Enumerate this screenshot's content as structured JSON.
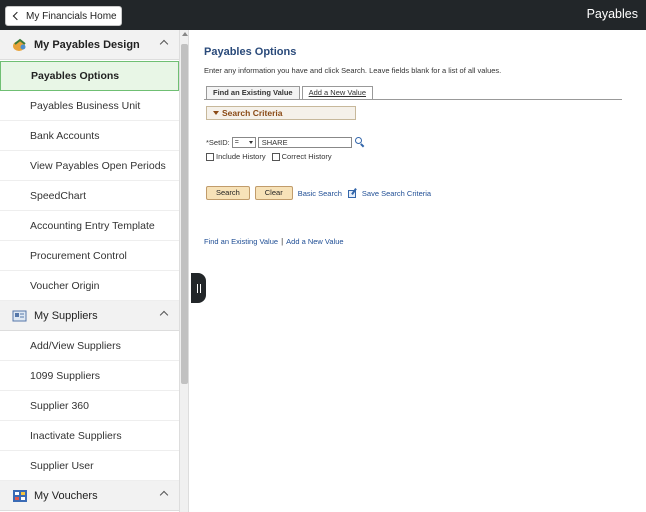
{
  "header": {
    "home_button": "My Financials Home",
    "app_title": "Payables"
  },
  "sidebar": {
    "groups": [
      {
        "title": "My Payables Design",
        "items": [
          "Payables Options",
          "Payables Business Unit",
          "Bank Accounts",
          "View Payables Open Periods",
          "SpeedChart",
          "Accounting Entry Template",
          "Procurement Control",
          "Voucher Origin"
        ]
      },
      {
        "title": "My Suppliers",
        "items": [
          "Add/View Suppliers",
          "1099 Suppliers",
          "Supplier 360",
          "Inactivate Suppliers",
          "Supplier User"
        ]
      },
      {
        "title": "My Vouchers",
        "items": []
      }
    ]
  },
  "main": {
    "title": "Payables Options",
    "instructions": "Enter any information you have and click Search. Leave fields blank for a list of all values.",
    "tabs": [
      "Find an Existing Value",
      "Add a New Value"
    ],
    "criteria_header": "Search Criteria",
    "setid_label": "*SetID:",
    "setid_operator": "=",
    "setid_value": "SHARE",
    "checkboxes": [
      "Include History",
      "Correct History"
    ],
    "search_button": "Search",
    "clear_button": "Clear",
    "basic_search_link": "Basic Search",
    "save_criteria_link": "Save Search Criteria",
    "bottom_links": [
      "Find an Existing Value",
      "Add a New Value"
    ]
  }
}
